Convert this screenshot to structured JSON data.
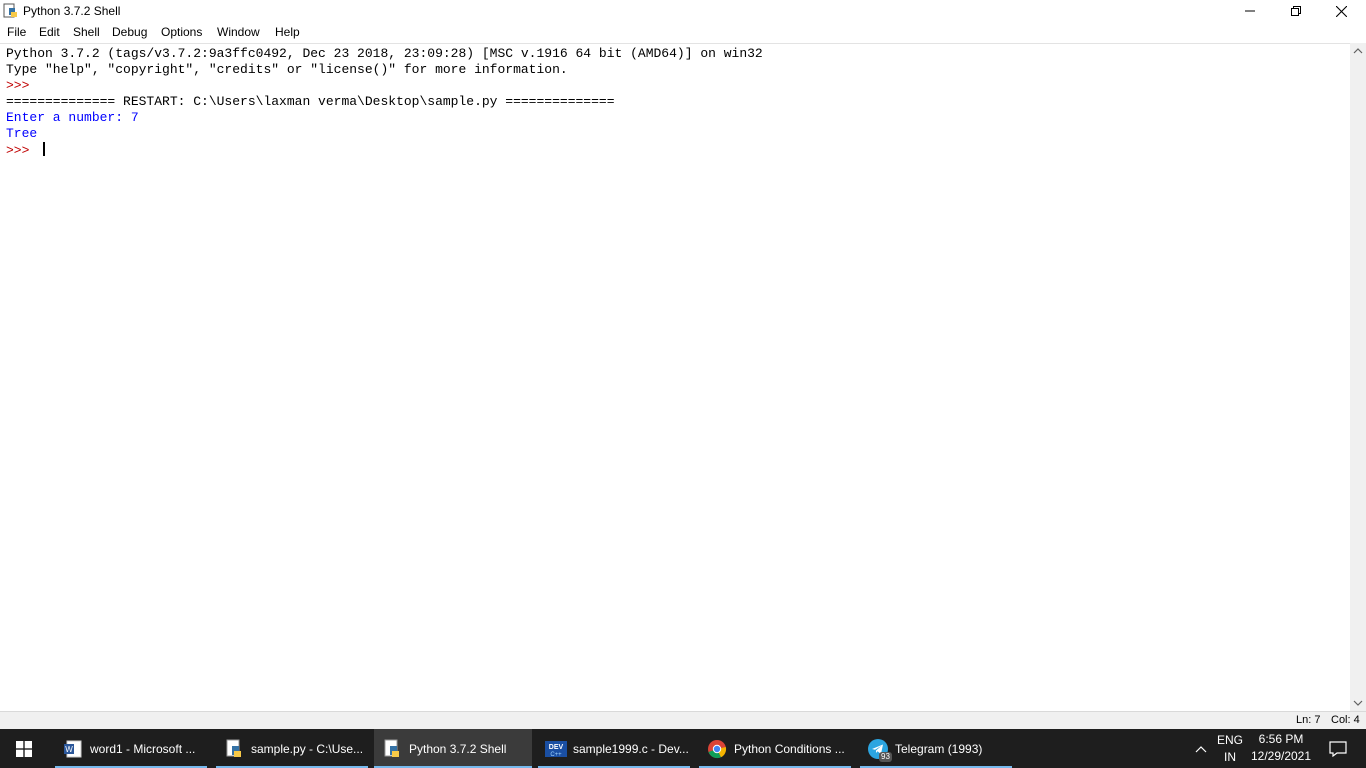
{
  "window": {
    "title": "Python 3.7.2 Shell"
  },
  "menu": [
    "File",
    "Edit",
    "Shell",
    "Debug",
    "Options",
    "Window",
    "Help"
  ],
  "shell": {
    "banner_line1": "Python 3.7.2 (tags/v3.7.2:9a3ffc0492, Dec 23 2018, 23:09:28) [MSC v.1916 64 bit (AMD64)] on win32",
    "banner_line2": "Type \"help\", \"copyright\", \"credits\" or \"license()\" for more information.",
    "prompt": ">>> ",
    "restart_line": "============== RESTART: C:\\Users\\laxman verma\\Desktop\\sample.py ==============",
    "input_line": "Enter a number: 7",
    "output_line": "Tree"
  },
  "status": {
    "ln": "Ln: 7",
    "col": "Col: 4"
  },
  "taskbar": {
    "items": [
      {
        "label": "word1 - Microsoft ...",
        "icon": "word-icon"
      },
      {
        "label": "sample.py - C:\\Use...",
        "icon": "python-file-icon"
      },
      {
        "label": "Python 3.7.2 Shell",
        "icon": "python-shell-icon"
      },
      {
        "label": "sample1999.c - Dev...",
        "icon": "devcpp-icon"
      },
      {
        "label": "Python Conditions ...",
        "icon": "chrome-icon"
      },
      {
        "label": "Telegram (1993)",
        "icon": "telegram-icon"
      }
    ],
    "telegram_badge": "93",
    "lang_top": "ENG",
    "lang_bottom": "IN",
    "time": "6:56 PM",
    "date": "12/29/2021"
  },
  "colors": {
    "prompt": "#c00000",
    "stdout": "#0000ff",
    "taskbar_bg": "#1e1e1e",
    "taskbar_accent": "#76b9ed"
  }
}
